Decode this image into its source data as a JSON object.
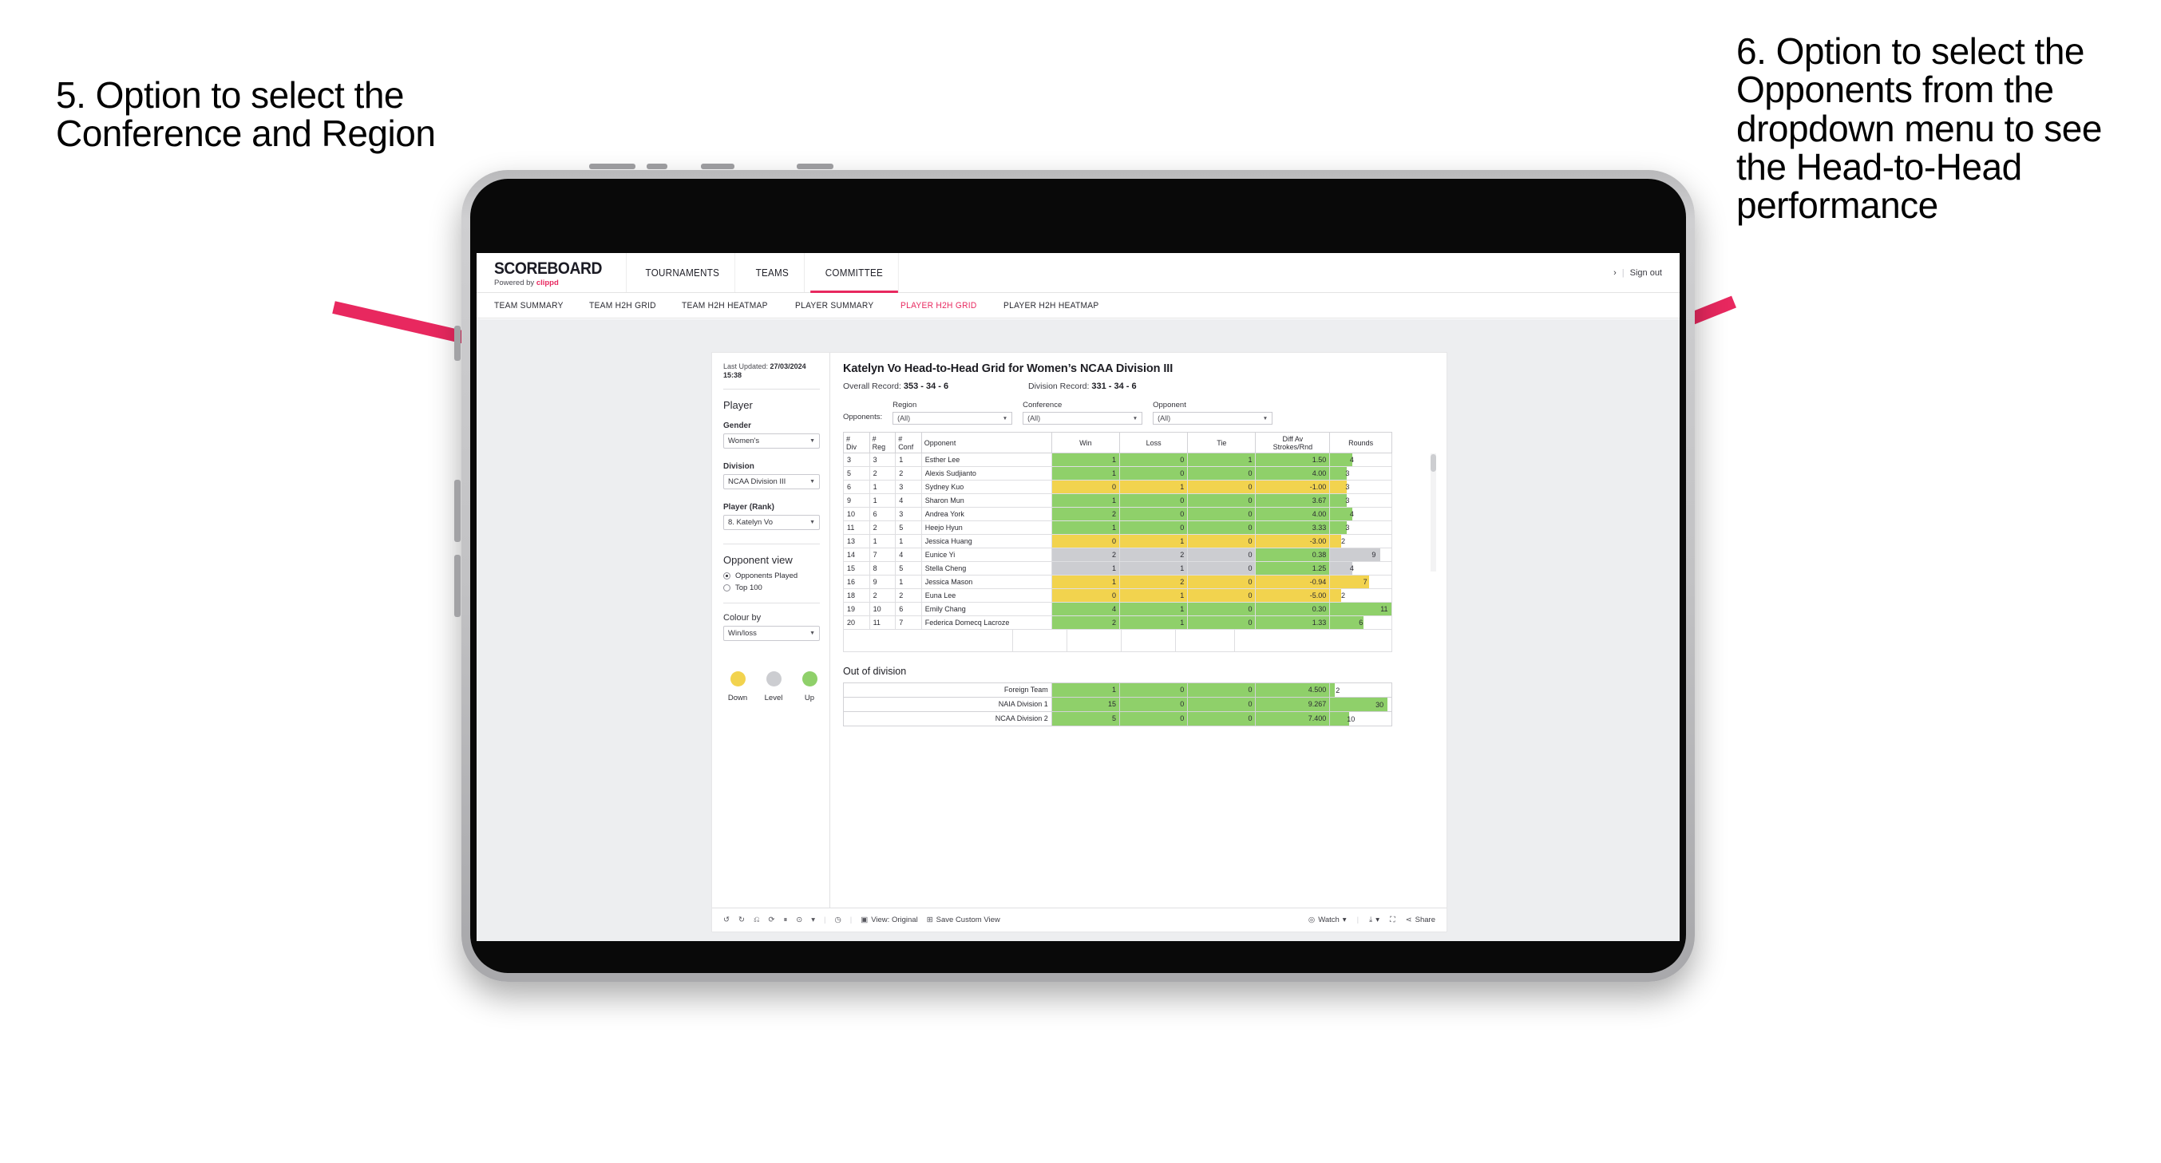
{
  "annotations": {
    "left": "5. Option to select the Conference and Region",
    "right": "6. Option to select the Opponents from the dropdown menu to see the Head-to-Head performance"
  },
  "colors": {
    "accent": "#e8285f",
    "up_green": "#8fd06a",
    "down_yellow": "#f2d34e",
    "level_grey": "#cccdd1",
    "arrow": "#e8285f"
  },
  "site_header": {
    "logo_word": "SCOREBOARD",
    "logo_sub_prefix": "Powered by ",
    "logo_sub_brand": "clippd",
    "nav": [
      {
        "label": "TOURNAMENTS",
        "active": false
      },
      {
        "label": "TEAMS",
        "active": false
      },
      {
        "label": "COMMITTEE",
        "active": true
      }
    ],
    "chevron": "›",
    "separator": "|",
    "sign_out": "Sign out"
  },
  "sub_nav": [
    {
      "label": "TEAM SUMMARY",
      "active": false
    },
    {
      "label": "TEAM H2H GRID",
      "active": false
    },
    {
      "label": "TEAM H2H HEATMAP",
      "active": false
    },
    {
      "label": "PLAYER SUMMARY",
      "active": false
    },
    {
      "label": "PLAYER H2H GRID",
      "active": true
    },
    {
      "label": "PLAYER H2H HEATMAP",
      "active": false
    }
  ],
  "sidebar": {
    "last_updated_label": "Last Updated: ",
    "last_updated_value": "27/03/2024",
    "last_updated_time": "15:38",
    "player_heading": "Player",
    "gender_label": "Gender",
    "gender_value": "Women's",
    "division_label": "Division",
    "division_value": "NCAA Division III",
    "player_rank_label": "Player (Rank)",
    "player_rank_value": "8. Katelyn Vo",
    "opponent_view_heading": "Opponent view",
    "opponent_view_options": [
      {
        "label": "Opponents Played",
        "selected": true
      },
      {
        "label": "Top 100",
        "selected": false
      }
    ],
    "colour_by_label": "Colour by",
    "colour_by_value": "Win/loss",
    "legend": [
      {
        "caption": "Down",
        "color": "#f2d34e"
      },
      {
        "caption": "Level",
        "color": "#cccdd1"
      },
      {
        "caption": "Up",
        "color": "#8fd06a"
      }
    ]
  },
  "viz": {
    "title": "Katelyn Vo Head-to-Head Grid for Women’s NCAA Division III",
    "overall_record_label": "Overall Record: ",
    "overall_record_value": "353 - 34 - 6",
    "division_record_label": "Division Record: ",
    "division_record_value": "331 - 34 - 6",
    "opponents_label": "Opponents:",
    "filters": [
      {
        "label": "Region",
        "value": "(All)"
      },
      {
        "label": "Conference",
        "value": "(All)"
      },
      {
        "label": "Opponent",
        "value": "(All)"
      }
    ],
    "columns": [
      "# Div",
      "# Reg",
      "# Conf",
      "Opponent",
      "Win",
      "Loss",
      "Tie",
      "Diff Av Strokes/Rnd",
      "Rounds"
    ],
    "column_head_lines": [
      [
        "#",
        "Div"
      ],
      [
        "#",
        "Reg"
      ],
      [
        "#",
        "Conf"
      ],
      [
        "Opponent"
      ],
      [
        "Win"
      ],
      [
        "Loss"
      ],
      [
        "Tie"
      ],
      [
        "Diff Av",
        "Strokes/Rnd"
      ],
      [
        "Rounds"
      ]
    ],
    "rows": [
      {
        "div": "3",
        "reg": "3",
        "conf": "1",
        "opponent": "Esther Lee",
        "win": "1",
        "loss": "0",
        "tie": "1",
        "diff": "1.50",
        "rounds": "4",
        "state": "up",
        "bar_pct": 36
      },
      {
        "div": "5",
        "reg": "2",
        "conf": "2",
        "opponent": "Alexis Sudjianto",
        "win": "1",
        "loss": "0",
        "tie": "0",
        "diff": "4.00",
        "rounds": "3",
        "state": "up",
        "bar_pct": 27
      },
      {
        "div": "6",
        "reg": "1",
        "conf": "3",
        "opponent": "Sydney Kuo",
        "win": "0",
        "loss": "1",
        "tie": "0",
        "diff": "-1.00",
        "rounds": "3",
        "state": "down",
        "bar_pct": 27
      },
      {
        "div": "9",
        "reg": "1",
        "conf": "4",
        "opponent": "Sharon Mun",
        "win": "1",
        "loss": "0",
        "tie": "0",
        "diff": "3.67",
        "rounds": "3",
        "state": "up",
        "bar_pct": 27
      },
      {
        "div": "10",
        "reg": "6",
        "conf": "3",
        "opponent": "Andrea York",
        "win": "2",
        "loss": "0",
        "tie": "0",
        "diff": "4.00",
        "rounds": "4",
        "state": "up",
        "bar_pct": 36
      },
      {
        "div": "11",
        "reg": "2",
        "conf": "5",
        "opponent": "Heejo Hyun",
        "win": "1",
        "loss": "0",
        "tie": "0",
        "diff": "3.33",
        "rounds": "3",
        "state": "up",
        "bar_pct": 27
      },
      {
        "div": "13",
        "reg": "1",
        "conf": "1",
        "opponent": "Jessica Huang",
        "win": "0",
        "loss": "1",
        "tie": "0",
        "diff": "-3.00",
        "rounds": "2",
        "state": "down",
        "bar_pct": 18
      },
      {
        "div": "14",
        "reg": "7",
        "conf": "4",
        "opponent": "Eunice Yi",
        "win": "2",
        "loss": "2",
        "tie": "0",
        "diff": "0.38",
        "rounds": "9",
        "state": "level",
        "bar_pct": 82,
        "diff_state": "up"
      },
      {
        "div": "15",
        "reg": "8",
        "conf": "5",
        "opponent": "Stella Cheng",
        "win": "1",
        "loss": "1",
        "tie": "0",
        "diff": "1.25",
        "rounds": "4",
        "state": "level",
        "bar_pct": 36,
        "diff_state": "up"
      },
      {
        "div": "16",
        "reg": "9",
        "conf": "1",
        "opponent": "Jessica Mason",
        "win": "1",
        "loss": "2",
        "tie": "0",
        "diff": "-0.94",
        "rounds": "7",
        "state": "down",
        "bar_pct": 64
      },
      {
        "div": "18",
        "reg": "2",
        "conf": "2",
        "opponent": "Euna Lee",
        "win": "0",
        "loss": "1",
        "tie": "0",
        "diff": "-5.00",
        "rounds": "2",
        "state": "down",
        "bar_pct": 18
      },
      {
        "div": "19",
        "reg": "10",
        "conf": "6",
        "opponent": "Emily Chang",
        "win": "4",
        "loss": "1",
        "tie": "0",
        "diff": "0.30",
        "rounds": "11",
        "state": "up",
        "bar_pct": 100
      },
      {
        "div": "20",
        "reg": "11",
        "conf": "7",
        "opponent": "Federica Domecq Lacroze",
        "win": "2",
        "loss": "1",
        "tie": "0",
        "diff": "1.33",
        "rounds": "6",
        "state": "up",
        "bar_pct": 55
      }
    ],
    "out_of_division_title": "Out of division",
    "out_of_division_rows": [
      {
        "name": "Foreign Team",
        "win": "1",
        "loss": "0",
        "tie": "0",
        "diff": "4.500",
        "rounds": "2",
        "state": "up",
        "bar_pct": 7
      },
      {
        "name": "NAIA Division 1",
        "win": "15",
        "loss": "0",
        "tie": "0",
        "diff": "9.267",
        "rounds": "30",
        "state": "up",
        "bar_pct": 93
      },
      {
        "name": "NCAA Division 2",
        "win": "5",
        "loss": "0",
        "tie": "0",
        "diff": "7.400",
        "rounds": "10",
        "state": "up",
        "bar_pct": 31
      }
    ]
  },
  "toolbar": {
    "undo": "undo-icon",
    "redo": "redo-icon",
    "revert": "revert-icon",
    "refresh": "refresh-data-icon",
    "pause": "pause-updates-icon",
    "alerts": "alerts-icon",
    "caret": "▾",
    "view_original": "View: Original",
    "save_custom_view": "Save Custom View",
    "watch": "Watch",
    "download": "download-icon",
    "fullscreen": "fullscreen-icon",
    "share": "Share"
  }
}
